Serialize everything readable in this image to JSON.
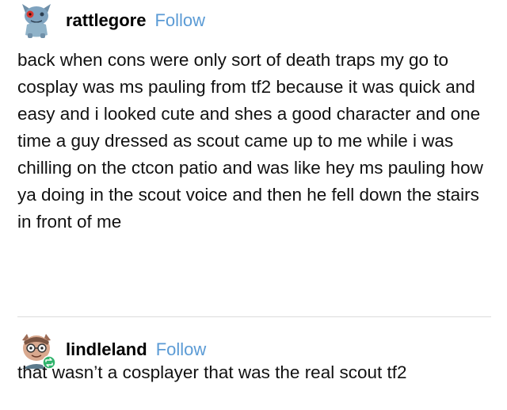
{
  "posts": [
    {
      "username": "rattlegore",
      "follow_label": "Follow",
      "body": "back when cons were only sort of death traps my go to cosplay was ms pauling from tf2 because it was quick and easy and i looked cute and shes a good character and one time a guy dressed as scout came up to me while i was chilling on the ctcon patio and was like hey ms pauling how ya doing in the scout voice and then he fell down the stairs in front of me"
    },
    {
      "username": "lindleland",
      "follow_label": "Follow",
      "body": "that wasn’t a cosplayer that was the real scout tf2"
    }
  ],
  "colors": {
    "follow": "#5b9bd5",
    "reblog_badge": "#2fb36b",
    "divider": "#dcdcdc"
  },
  "icons": {
    "avatar_1": "creature-avatar-icon",
    "avatar_2": "person-with-glasses-avatar-icon",
    "reblog_badge": "reblog-icon"
  }
}
